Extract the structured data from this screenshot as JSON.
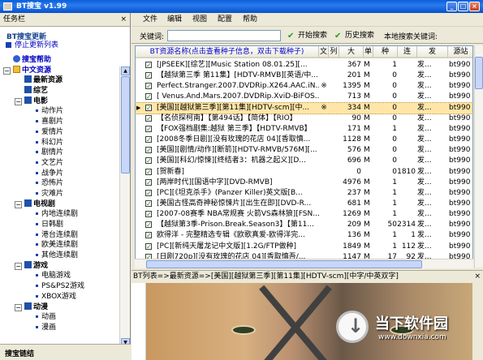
{
  "window": {
    "title": "BT搜宝 v1.99"
  },
  "taskpane": {
    "title": "任务栏",
    "section_title": "BT搜宝更新",
    "stop_update": "停止更新列表",
    "tree": [
      {
        "label": "搜宝帮助",
        "level": 1,
        "icon": "help-icon",
        "bold": true,
        "color": "#0000c0"
      },
      {
        "label": "中文资源",
        "level": 1,
        "icon": "folder-icon",
        "bold": true,
        "color": "#0000c0",
        "expanded": true
      },
      {
        "label": "最新资源",
        "level": 2,
        "icon": "book-icon",
        "bold": true
      },
      {
        "label": "综艺",
        "level": 2,
        "icon": "book-icon",
        "bold": true
      },
      {
        "label": "电影",
        "level": 2,
        "icon": "book-icon",
        "bold": true,
        "expanded": true
      },
      {
        "label": "动作片",
        "level": 3
      },
      {
        "label": "喜剧片",
        "level": 3
      },
      {
        "label": "爱情片",
        "level": 3
      },
      {
        "label": "科幻片",
        "level": 3
      },
      {
        "label": "剧情片",
        "level": 3
      },
      {
        "label": "文艺片",
        "level": 3
      },
      {
        "label": "战争片",
        "level": 3
      },
      {
        "label": "恐怖片",
        "level": 3
      },
      {
        "label": "灾难片",
        "level": 3
      },
      {
        "label": "电视剧",
        "level": 2,
        "icon": "book-icon",
        "bold": true,
        "expanded": true
      },
      {
        "label": "内地连续剧",
        "level": 3
      },
      {
        "label": "日韩剧",
        "level": 3
      },
      {
        "label": "港台连续剧",
        "level": 3
      },
      {
        "label": "欧美连续剧",
        "level": 3
      },
      {
        "label": "其他连续剧",
        "level": 3
      },
      {
        "label": "游戏",
        "level": 2,
        "icon": "book-icon",
        "bold": true,
        "expanded": true
      },
      {
        "label": "电脑游戏",
        "level": 3
      },
      {
        "label": "PS&PS2游戏",
        "level": 3
      },
      {
        "label": "XBOX游戏",
        "level": 3
      },
      {
        "label": "动漫",
        "level": 2,
        "icon": "book-icon",
        "bold": true,
        "expanded": true
      },
      {
        "label": "动画",
        "level": 3
      },
      {
        "label": "漫画",
        "level": 3
      }
    ],
    "links_title": "搜宝链结"
  },
  "menu": [
    "文件",
    "编辑",
    "视图",
    "配置",
    "帮助"
  ],
  "search": {
    "label": "关键词:",
    "value": "",
    "start_button": "开始搜索",
    "history_button": "历史搜索",
    "local_keyword": "本地搜索关键词:"
  },
  "table": {
    "headers": [
      "BT资源名称(点击查看种子信息，双击下载种子)",
      "文",
      "列",
      "大",
      "单",
      "种",
      "连",
      "发",
      "源站"
    ],
    "rows": [
      {
        "name": "[JPSEEK][综艺][Music Station 08.01.25][...",
        "c3": "",
        "c4": "",
        "size": "367",
        "unit": "M",
        "seeds": "1",
        "links": "",
        "pub": "发...",
        "src": "bt990"
      },
      {
        "name": "【越狱第三季 第11集】[HDTV-RMVB][英语/中...",
        "c3": "",
        "c4": "",
        "size": "201",
        "unit": "M",
        "seeds": "0",
        "links": "",
        "pub": "发...",
        "src": "bt990"
      },
      {
        "name": "Perfect.Stranger.2007.DVDRip.X264.AAC.iN...",
        "c3": "※",
        "c4": "",
        "size": "1395",
        "unit": "M",
        "seeds": "0",
        "links": "",
        "pub": "发...",
        "src": "bt990"
      },
      {
        "name": "[ Venus.And.Mars.2007.DVDRip.XviD-BiFOS...",
        "c3": "",
        "c4": "",
        "size": "713",
        "unit": "M",
        "seeds": "0",
        "links": "",
        "pub": "发...",
        "src": "bt990"
      },
      {
        "name": "[美国][越狱第三季][第11集][HDTV-scm][中...",
        "c3": "※",
        "c4": "",
        "size": "334",
        "unit": "M",
        "seeds": "0",
        "links": "",
        "pub": "发...",
        "src": "bt990",
        "selected": true
      },
      {
        "name": "【名侦探柯南】【第494话】【简体】【RIO】",
        "c3": "",
        "c4": "",
        "size": "90",
        "unit": "M",
        "seeds": "0",
        "links": "",
        "pub": "发...",
        "src": "bt990"
      },
      {
        "name": "【FOX强档剧集:越狱 第三季】【HDTV-RMVB】",
        "c3": "",
        "c4": "",
        "size": "171",
        "unit": "M",
        "seeds": "1",
        "links": "",
        "pub": "发...",
        "src": "bt990"
      },
      {
        "name": "[2008冬季日剧][没有玫瑰的花店 04][香取慎...",
        "c3": "",
        "c4": "",
        "size": "1128",
        "unit": "M",
        "seeds": "0",
        "links": "",
        "pub": "发...",
        "src": "bt990"
      },
      {
        "name": "[美国][剧情/动作][断箭][HDTV-RMVB/576M][...",
        "c3": "",
        "c4": "",
        "size": "576",
        "unit": "M",
        "seeds": "0",
        "links": "",
        "pub": "发...",
        "src": "bt990"
      },
      {
        "name": "[美国][科幻/惊悚][终结者3：机器之起义][D...",
        "c3": "",
        "c4": "",
        "size": "696",
        "unit": "M",
        "seeds": "0",
        "links": "",
        "pub": "发...",
        "src": "bt990"
      },
      {
        "name": "[贺新春]",
        "c3": "",
        "c4": "",
        "size": "0",
        "unit": "",
        "seeds": "0",
        "links": "1810",
        "pub": "发...",
        "src": "bt990"
      },
      {
        "name": "[两岸时代][国语中字][DVD-RMVB]",
        "c3": "",
        "c4": "",
        "size": "4976",
        "unit": "M",
        "seeds": "1",
        "links": "",
        "pub": "发...",
        "src": "bt990"
      },
      {
        "name": "[PC][《坦克杀手》(Panzer Killer)英文版[B...",
        "c3": "",
        "c4": "",
        "size": "237",
        "unit": "M",
        "seeds": "1",
        "links": "",
        "pub": "发...",
        "src": "bt990"
      },
      {
        "name": "[美国古怪高奇神秘惊悚片][出生在即][DVD-R...",
        "c3": "",
        "c4": "",
        "size": "681",
        "unit": "M",
        "seeds": "1",
        "links": "",
        "pub": "发...",
        "src": "bt990"
      },
      {
        "name": "[2007-08赛季 NBA常规赛 火箭VS森林狼][FSN...",
        "c3": "",
        "c4": "",
        "size": "1269",
        "unit": "M",
        "seeds": "1",
        "links": "",
        "pub": "发...",
        "src": "bt990"
      },
      {
        "name": "【越狱第3季-Prison.Break.Season3】【第11...",
        "c3": "",
        "c4": "",
        "size": "209",
        "unit": "M",
        "seeds": "50",
        "links": "2314",
        "pub": "发...",
        "src": "bt990"
      },
      {
        "name": "欧得洋 - 完整精选专辑《欧歌真爱-欧得洋完...",
        "c3": "",
        "c4": "",
        "size": "136",
        "unit": "M",
        "seeds": "1",
        "links": "1",
        "pub": "发...",
        "src": "bt990"
      },
      {
        "name": "[PC][新纯天屠龙记中文版][1.2G/FTP做种]",
        "c3": "",
        "c4": "",
        "size": "1849",
        "unit": "M",
        "seeds": "1",
        "links": "112",
        "pub": "发...",
        "src": "bt990"
      },
      {
        "name": "[日剧720p][没有玫瑰的花店 04][香取慎吾/...",
        "c3": "",
        "c4": "",
        "size": "1147",
        "unit": "M",
        "seeds": "17",
        "links": "92",
        "pub": "发...",
        "src": "bt990"
      },
      {
        "name": "[PC][哥特王朝3中文版][4.6G/FTP做种]",
        "c3": "",
        "c4": "",
        "size": "4766",
        "unit": "M",
        "seeds": "2",
        "links": "22",
        "pub": "发...",
        "src": "bt990"
      }
    ]
  },
  "preview": {
    "path": "BT列表=>最新资源=>[美国][越狱第三季][第11集][HDTV-scm][中字/中英双字]"
  },
  "watermark": {
    "title": "当下软件园",
    "url": "www.downxia.com"
  }
}
